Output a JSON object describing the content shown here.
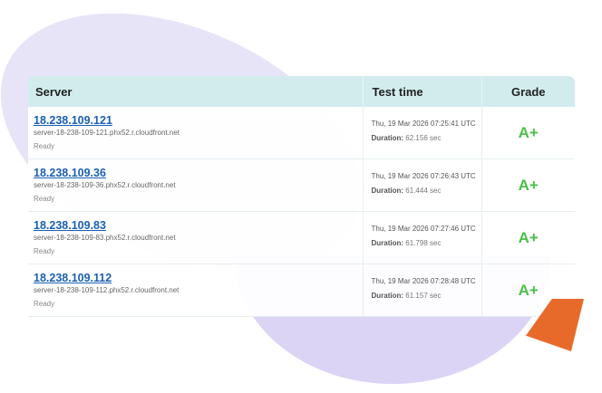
{
  "table": {
    "headers": {
      "server": "Server",
      "test_time": "Test time",
      "grade": "Grade"
    },
    "rows": [
      {
        "ip": "18.238.109.121",
        "hostname": "server-18-238-109-121.phx52.r.cloudfront.net",
        "status": "Ready",
        "test_time": "Thu, 19 Mar 2026 07:25:41 UTC",
        "duration_label": "Duration:",
        "duration": "62.156 sec",
        "grade": "A+"
      },
      {
        "ip": "18.238.109.36",
        "hostname": "server-18-238-109-36.phx52.r.cloudfront.net",
        "status": "Ready",
        "test_time": "Thu, 19 Mar 2026 07:26:43 UTC",
        "duration_label": "Duration:",
        "duration": "61.444 sec",
        "grade": "A+"
      },
      {
        "ip": "18.238.109.83",
        "hostname": "server-18-238-109-83.phx52.r.cloudfront.net",
        "status": "Ready",
        "test_time": "Thu, 19 Mar 2026 07:27:46 UTC",
        "duration_label": "Duration:",
        "duration": "61.798 sec",
        "grade": "A+"
      },
      {
        "ip": "18.238.109.112",
        "hostname": "server-18-238-109-112.phx52.r.cloudfront.net",
        "status": "Ready",
        "test_time": "Thu, 19 Mar 2026 07:28:48 UTC",
        "duration_label": "Duration:",
        "duration": "61.157 sec",
        "grade": "A+"
      }
    ]
  },
  "colors": {
    "header_bg": "#d2ecee",
    "link": "#1a5fb4",
    "grade": "#4bbf49",
    "blob_light": "#e8e4f7",
    "blob_dark": "#dbd4f5",
    "accent_shape": "#e86a2b"
  }
}
